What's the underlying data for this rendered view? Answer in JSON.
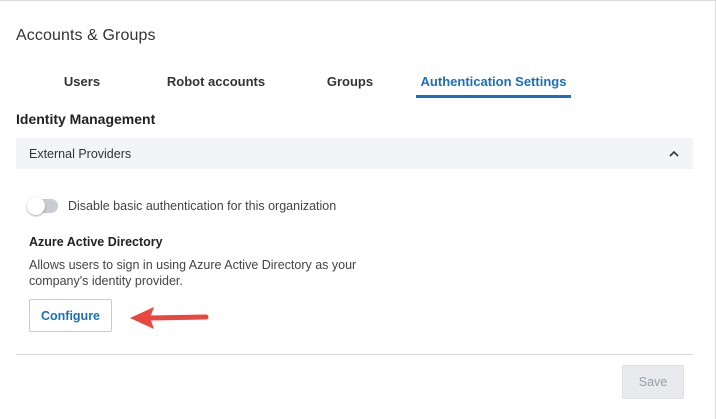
{
  "page": {
    "title": "Accounts & Groups"
  },
  "tabs": [
    {
      "label": "Users",
      "active": false
    },
    {
      "label": "Robot accounts",
      "active": false
    },
    {
      "label": "Groups",
      "active": false
    },
    {
      "label": "Authentication Settings",
      "active": true
    }
  ],
  "section": {
    "title": "Identity Management"
  },
  "panel": {
    "header": "External Providers",
    "expanded": true,
    "toggle": {
      "label": "Disable basic authentication for this organization",
      "on": false
    },
    "provider": {
      "title": "Azure Active Directory",
      "description": "Allows users to sign in using Azure Active Directory as your company's identity provider.",
      "button_label": "Configure"
    }
  },
  "footer": {
    "save_label": "Save",
    "save_enabled": false
  },
  "colors": {
    "accent": "#1a6fbf",
    "annotation_arrow": "#e8463f",
    "panel_bg": "#f2f4f7"
  }
}
